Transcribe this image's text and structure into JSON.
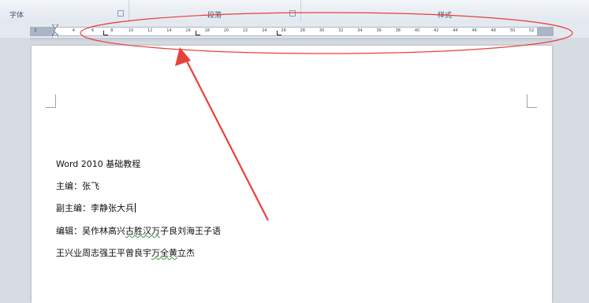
{
  "ribbon": {
    "groups": [
      {
        "label": "字体"
      },
      {
        "label": "段落"
      },
      {
        "label": "样式"
      }
    ]
  },
  "ruler": {
    "ticks": [
      "2",
      "2",
      "4",
      "6",
      "8",
      "10",
      "12",
      "14",
      "16",
      "18",
      "20",
      "22",
      "24",
      "26",
      "28",
      "30",
      "32",
      "34",
      "36",
      "38",
      "40",
      "42",
      "44",
      "46",
      "48",
      "50",
      "52"
    ]
  },
  "document": {
    "lines": [
      {
        "text": "Word 2010 基础教程"
      },
      {
        "text": "主编：张飞"
      },
      {
        "text": "副主编：李静张大兵"
      },
      {
        "text_prefix": "编辑：吴作林高兴",
        "text_underlined_1": "古胜汉万",
        "text_mid": "子良刘海王子语"
      },
      {
        "text_prefix": "王兴业周志强王平曾良宇",
        "text_underlined_1": "万全黄",
        "text_mid": "立杰"
      }
    ]
  },
  "colors": {
    "annotation": "#e8403a",
    "proof_underline": "#3a9a3a"
  }
}
